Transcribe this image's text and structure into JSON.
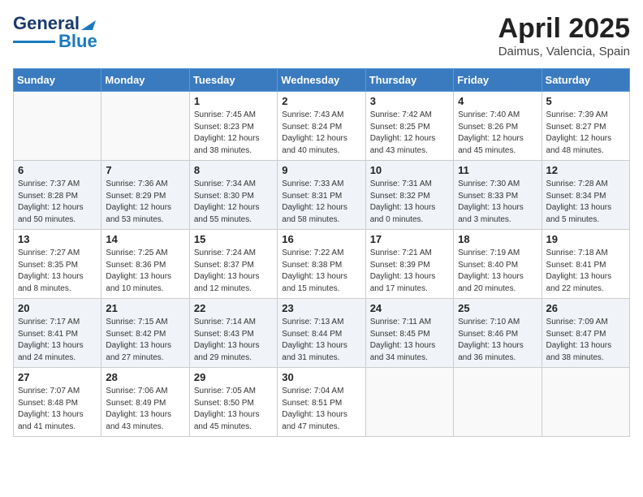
{
  "header": {
    "logo_line1": "General",
    "logo_line2": "Blue",
    "title": "April 2025",
    "subtitle": "Daimus, Valencia, Spain"
  },
  "days_of_week": [
    "Sunday",
    "Monday",
    "Tuesday",
    "Wednesday",
    "Thursday",
    "Friday",
    "Saturday"
  ],
  "weeks": [
    [
      {
        "day": "",
        "info": ""
      },
      {
        "day": "",
        "info": ""
      },
      {
        "day": "1",
        "info": "Sunrise: 7:45 AM\nSunset: 8:23 PM\nDaylight: 12 hours and 38 minutes."
      },
      {
        "day": "2",
        "info": "Sunrise: 7:43 AM\nSunset: 8:24 PM\nDaylight: 12 hours and 40 minutes."
      },
      {
        "day": "3",
        "info": "Sunrise: 7:42 AM\nSunset: 8:25 PM\nDaylight: 12 hours and 43 minutes."
      },
      {
        "day": "4",
        "info": "Sunrise: 7:40 AM\nSunset: 8:26 PM\nDaylight: 12 hours and 45 minutes."
      },
      {
        "day": "5",
        "info": "Sunrise: 7:39 AM\nSunset: 8:27 PM\nDaylight: 12 hours and 48 minutes."
      }
    ],
    [
      {
        "day": "6",
        "info": "Sunrise: 7:37 AM\nSunset: 8:28 PM\nDaylight: 12 hours and 50 minutes."
      },
      {
        "day": "7",
        "info": "Sunrise: 7:36 AM\nSunset: 8:29 PM\nDaylight: 12 hours and 53 minutes."
      },
      {
        "day": "8",
        "info": "Sunrise: 7:34 AM\nSunset: 8:30 PM\nDaylight: 12 hours and 55 minutes."
      },
      {
        "day": "9",
        "info": "Sunrise: 7:33 AM\nSunset: 8:31 PM\nDaylight: 12 hours and 58 minutes."
      },
      {
        "day": "10",
        "info": "Sunrise: 7:31 AM\nSunset: 8:32 PM\nDaylight: 13 hours and 0 minutes."
      },
      {
        "day": "11",
        "info": "Sunrise: 7:30 AM\nSunset: 8:33 PM\nDaylight: 13 hours and 3 minutes."
      },
      {
        "day": "12",
        "info": "Sunrise: 7:28 AM\nSunset: 8:34 PM\nDaylight: 13 hours and 5 minutes."
      }
    ],
    [
      {
        "day": "13",
        "info": "Sunrise: 7:27 AM\nSunset: 8:35 PM\nDaylight: 13 hours and 8 minutes."
      },
      {
        "day": "14",
        "info": "Sunrise: 7:25 AM\nSunset: 8:36 PM\nDaylight: 13 hours and 10 minutes."
      },
      {
        "day": "15",
        "info": "Sunrise: 7:24 AM\nSunset: 8:37 PM\nDaylight: 13 hours and 12 minutes."
      },
      {
        "day": "16",
        "info": "Sunrise: 7:22 AM\nSunset: 8:38 PM\nDaylight: 13 hours and 15 minutes."
      },
      {
        "day": "17",
        "info": "Sunrise: 7:21 AM\nSunset: 8:39 PM\nDaylight: 13 hours and 17 minutes."
      },
      {
        "day": "18",
        "info": "Sunrise: 7:19 AM\nSunset: 8:40 PM\nDaylight: 13 hours and 20 minutes."
      },
      {
        "day": "19",
        "info": "Sunrise: 7:18 AM\nSunset: 8:41 PM\nDaylight: 13 hours and 22 minutes."
      }
    ],
    [
      {
        "day": "20",
        "info": "Sunrise: 7:17 AM\nSunset: 8:41 PM\nDaylight: 13 hours and 24 minutes."
      },
      {
        "day": "21",
        "info": "Sunrise: 7:15 AM\nSunset: 8:42 PM\nDaylight: 13 hours and 27 minutes."
      },
      {
        "day": "22",
        "info": "Sunrise: 7:14 AM\nSunset: 8:43 PM\nDaylight: 13 hours and 29 minutes."
      },
      {
        "day": "23",
        "info": "Sunrise: 7:13 AM\nSunset: 8:44 PM\nDaylight: 13 hours and 31 minutes."
      },
      {
        "day": "24",
        "info": "Sunrise: 7:11 AM\nSunset: 8:45 PM\nDaylight: 13 hours and 34 minutes."
      },
      {
        "day": "25",
        "info": "Sunrise: 7:10 AM\nSunset: 8:46 PM\nDaylight: 13 hours and 36 minutes."
      },
      {
        "day": "26",
        "info": "Sunrise: 7:09 AM\nSunset: 8:47 PM\nDaylight: 13 hours and 38 minutes."
      }
    ],
    [
      {
        "day": "27",
        "info": "Sunrise: 7:07 AM\nSunset: 8:48 PM\nDaylight: 13 hours and 41 minutes."
      },
      {
        "day": "28",
        "info": "Sunrise: 7:06 AM\nSunset: 8:49 PM\nDaylight: 13 hours and 43 minutes."
      },
      {
        "day": "29",
        "info": "Sunrise: 7:05 AM\nSunset: 8:50 PM\nDaylight: 13 hours and 45 minutes."
      },
      {
        "day": "30",
        "info": "Sunrise: 7:04 AM\nSunset: 8:51 PM\nDaylight: 13 hours and 47 minutes."
      },
      {
        "day": "",
        "info": ""
      },
      {
        "day": "",
        "info": ""
      },
      {
        "day": "",
        "info": ""
      }
    ]
  ]
}
